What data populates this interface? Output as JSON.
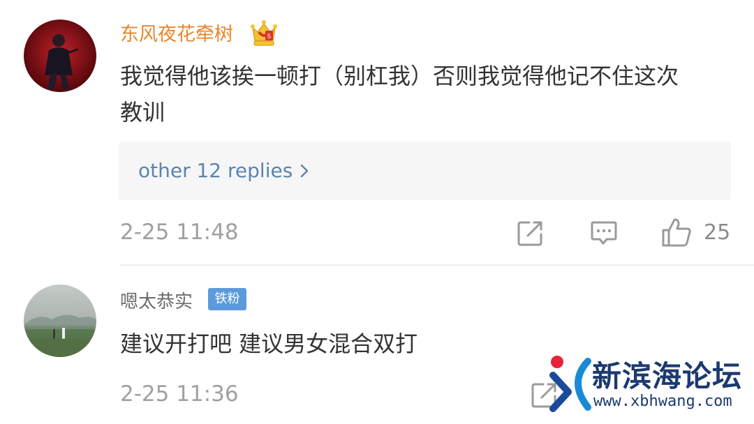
{
  "comments": [
    {
      "username": "东风夜花牵树",
      "text_line1": "我觉得他该挨一顿打（别杠我）否则我觉得他记不住这次",
      "text_line2": "教训",
      "replies_link": "other 12 replies",
      "timestamp": "2-25 11:48",
      "like_count": "25"
    },
    {
      "username": "嗯太恭实",
      "badge": "铁粉",
      "text": "建议开打吧   建议男女混合双打",
      "timestamp": "2-25 11:36"
    }
  ],
  "watermark": {
    "name": "新滨海论坛",
    "url": "www.xbhwang.com"
  },
  "colors": {
    "username_vip": "#e8862b",
    "link": "#5b84b0",
    "badge": "#5b9bdb",
    "watermark": "#1c3a70"
  }
}
